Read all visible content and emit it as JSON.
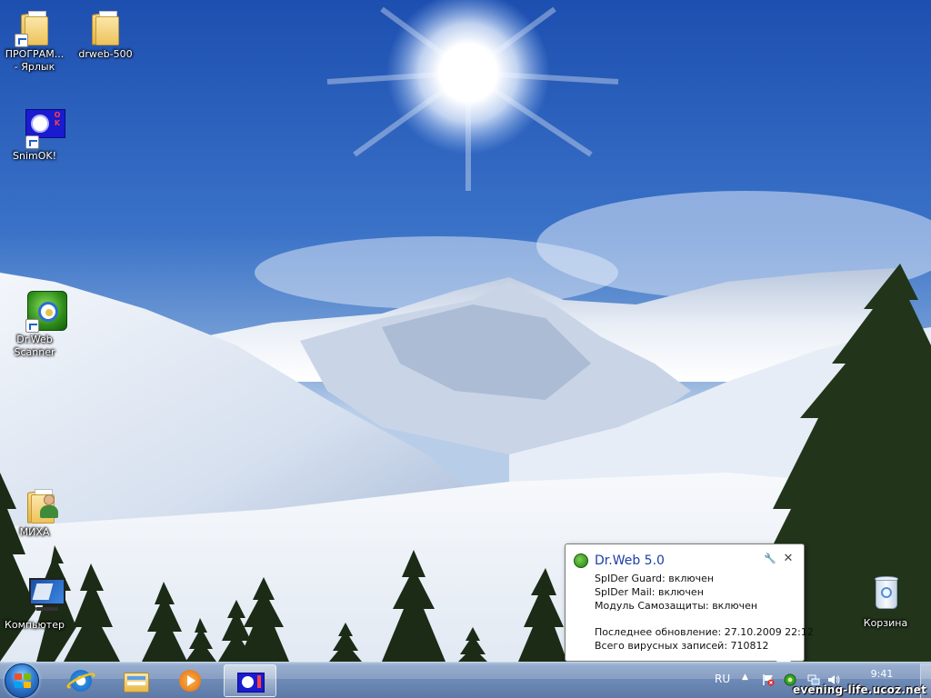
{
  "desktop": {
    "icons": [
      {
        "label": "ПРОГРАМ...\n- Ярлык",
        "label_line1": "ПРОГРАМ...",
        "label_line2": "- Ярлык",
        "icon": "folder-shortcut-icon"
      },
      {
        "label": "drweb-500",
        "icon": "folder-icon"
      },
      {
        "label": "SnimOK!",
        "icon": "snimok-app-icon"
      },
      {
        "label_line1": "Dr.Web",
        "label_line2": "Scanner",
        "icon": "drweb-scanner-icon"
      },
      {
        "label": "МИХА",
        "icon": "user-folder-icon"
      },
      {
        "label": "Компьютер",
        "icon": "computer-icon"
      },
      {
        "label": "Корзина",
        "icon": "recycle-bin-icon"
      }
    ]
  },
  "balloon": {
    "title": "Dr.Web 5.0",
    "lines": [
      "SpIDer Guard: включен",
      "SpIDer Mail: включен",
      "Модуль Самозащиты: включен",
      "Последнее обновление: 27.10.2009 22:12",
      "Всего вирусных записей: 710812"
    ],
    "close_glyph": "✕",
    "settings_glyph": "🔧"
  },
  "taskbar": {
    "start_icon": "windows-start-icon",
    "pinned": [
      "internet-explorer-icon",
      "explorer-icon",
      "media-player-icon",
      "snimok-app-icon"
    ],
    "language": "RU",
    "clock_time": "9:41",
    "watermark": "evening-life.ucoz.net"
  },
  "colors": {
    "sky": "#2f62b6",
    "balloon_title": "#1e3ea8",
    "taskbar": "#6f8bb7"
  }
}
